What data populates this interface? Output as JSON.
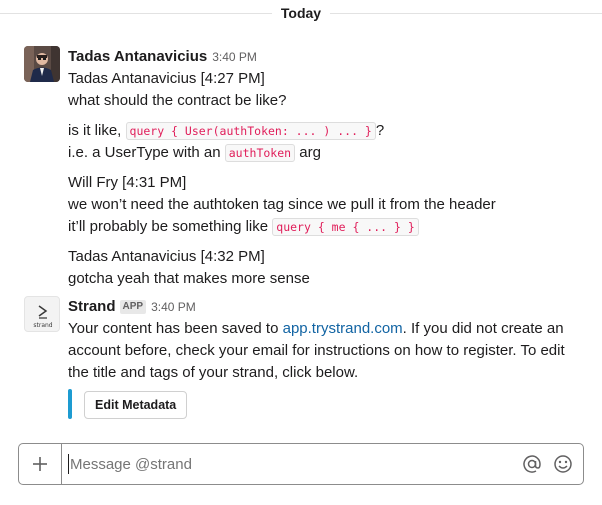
{
  "divider": {
    "label": "Today"
  },
  "messages": [
    {
      "sender": "Tadas Antanavicius",
      "time": "3:40 PM",
      "lines": [
        "Tadas Antanavicius [4:27 PM]",
        "what should the contract be like?",
        "is it like,",
        "query { User(authToken: ... )  ... }",
        "?",
        "i.e. a UserType with an",
        "authToken",
        "arg",
        "Will Fry [4:31 PM]",
        "we won’t need the authtoken tag since we pull it from the header",
        "it’ll probably be something like",
        "query { me { ... } }",
        "Tadas Antanavicius [4:32 PM]",
        "gotcha yeah that makes more sense"
      ]
    },
    {
      "sender": "Strand",
      "badge": "APP",
      "time": "3:40 PM",
      "avatar_label": "strand",
      "text_before_link": "Your content has been saved to ",
      "link": "app.trystrand.com",
      "text_line1_after": ". If you did not create an",
      "text_line2": "account before, check your email for instructions on how to register. To edit",
      "text_line3": "the title and tags of your strand, click below.",
      "button": "Edit Metadata"
    }
  ],
  "composer": {
    "placeholder": "Message @strand",
    "plus_icon": "plus-icon",
    "mention_icon": "at-icon",
    "emoji_icon": "emoji-icon"
  },
  "colors": {
    "accent_bar": "#1d9bd1",
    "link": "#1264a3",
    "code": "#e01e5a"
  }
}
